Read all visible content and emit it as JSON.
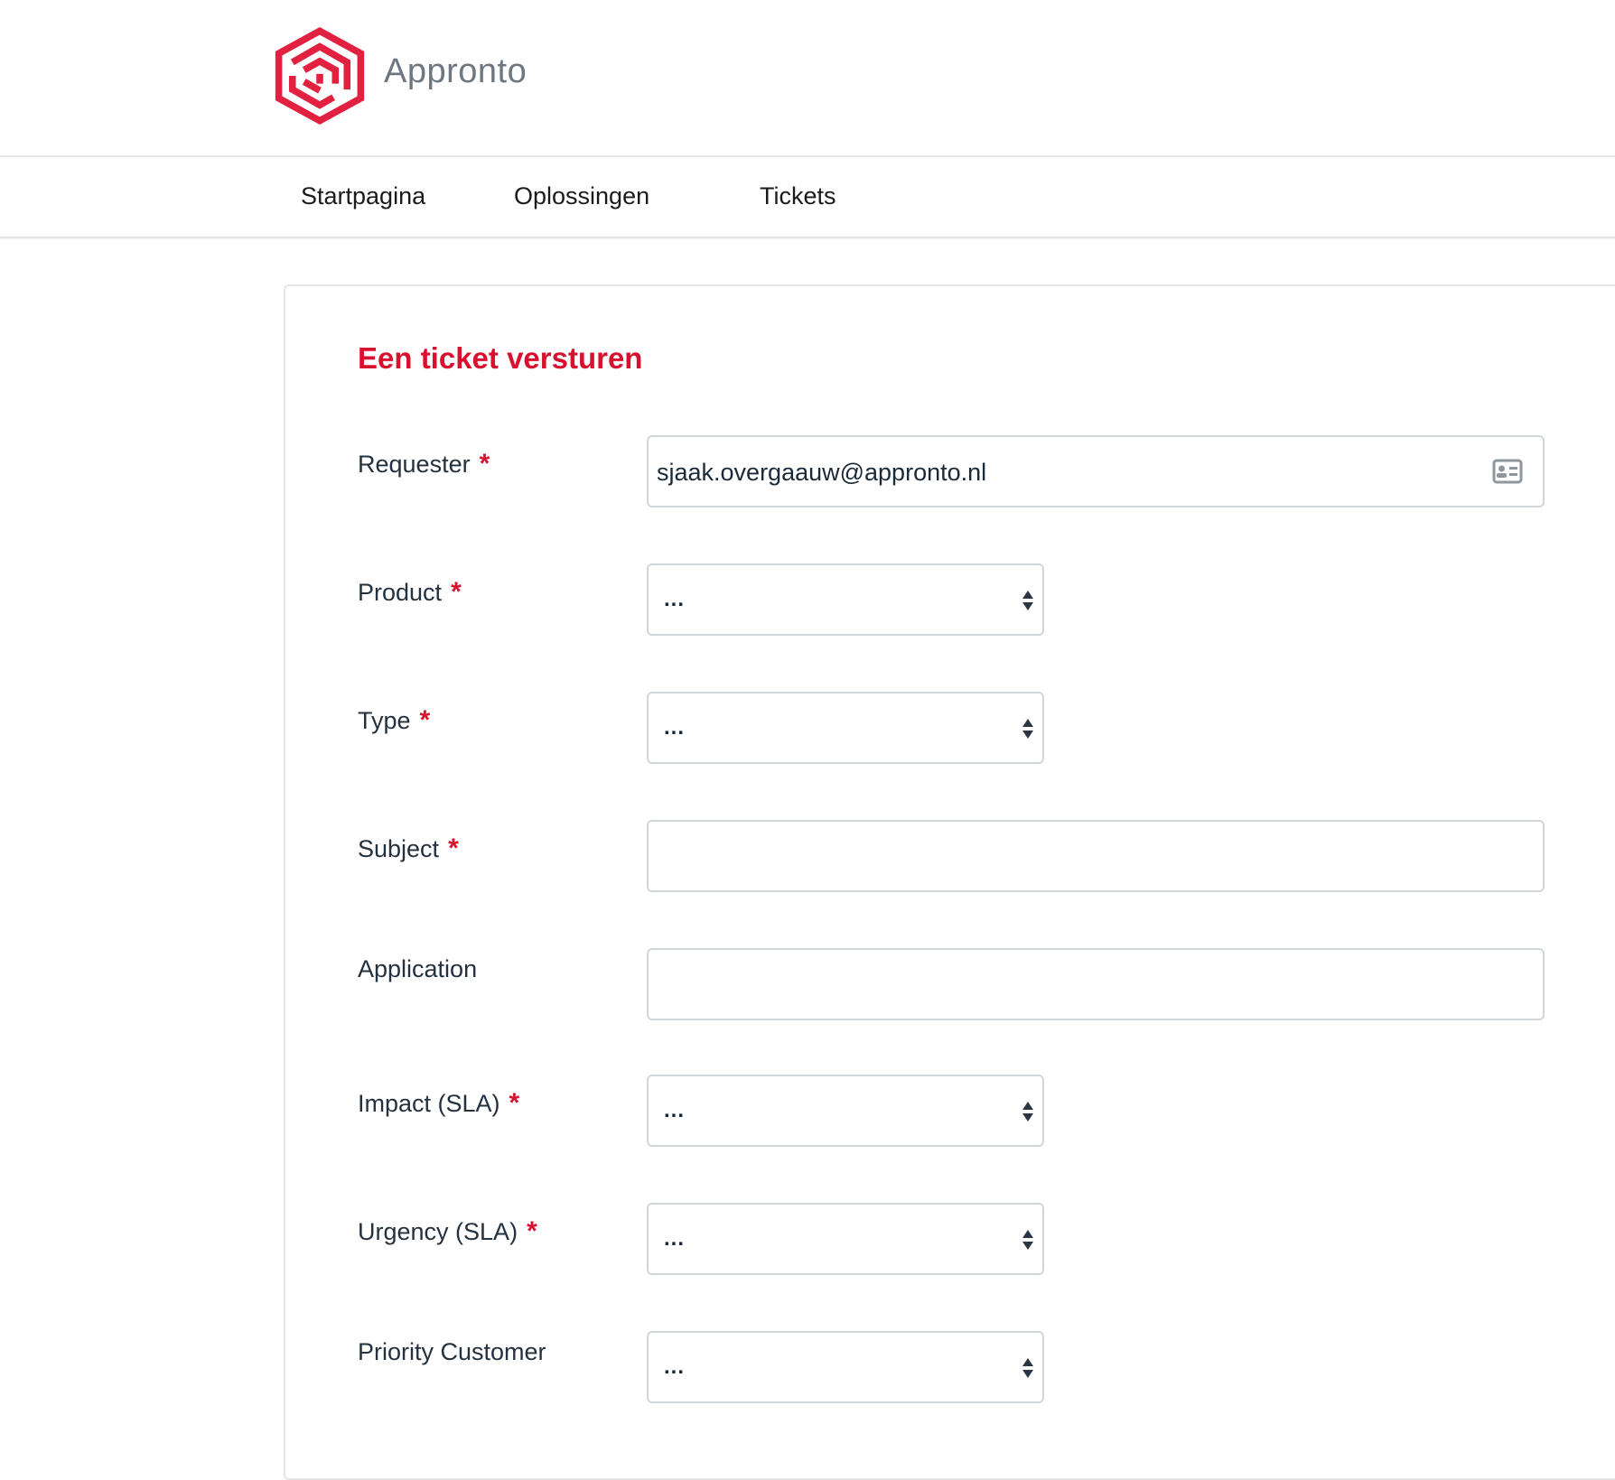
{
  "brand": {
    "name": "Appronto",
    "accent_color": "#d8112e",
    "logo_icon": "appronto-maze-hexagon-logo"
  },
  "nav": {
    "items": [
      {
        "label": "Startpagina"
      },
      {
        "label": "Oplossingen"
      },
      {
        "label": "Tickets"
      }
    ]
  },
  "form": {
    "title": "Een ticket versturen",
    "required_marker": "*",
    "fields": {
      "requester": {
        "label": "Requester",
        "value": "sjaak.overgaauw@appronto.nl",
        "icon": "contact-card-icon",
        "required": true
      },
      "product": {
        "label": "Product",
        "value": "...",
        "required": true
      },
      "type": {
        "label": "Type",
        "value": "...",
        "required": true
      },
      "subject": {
        "label": "Subject",
        "value": "",
        "required": true
      },
      "application": {
        "label": "Application",
        "value": "",
        "required": false
      },
      "impact": {
        "label": "Impact (SLA)",
        "value": "...",
        "required": true
      },
      "urgency": {
        "label": "Urgency (SLA)",
        "value": "...",
        "required": true
      },
      "priority_customer": {
        "label": "Priority Customer",
        "value": "...",
        "required": false
      }
    }
  }
}
